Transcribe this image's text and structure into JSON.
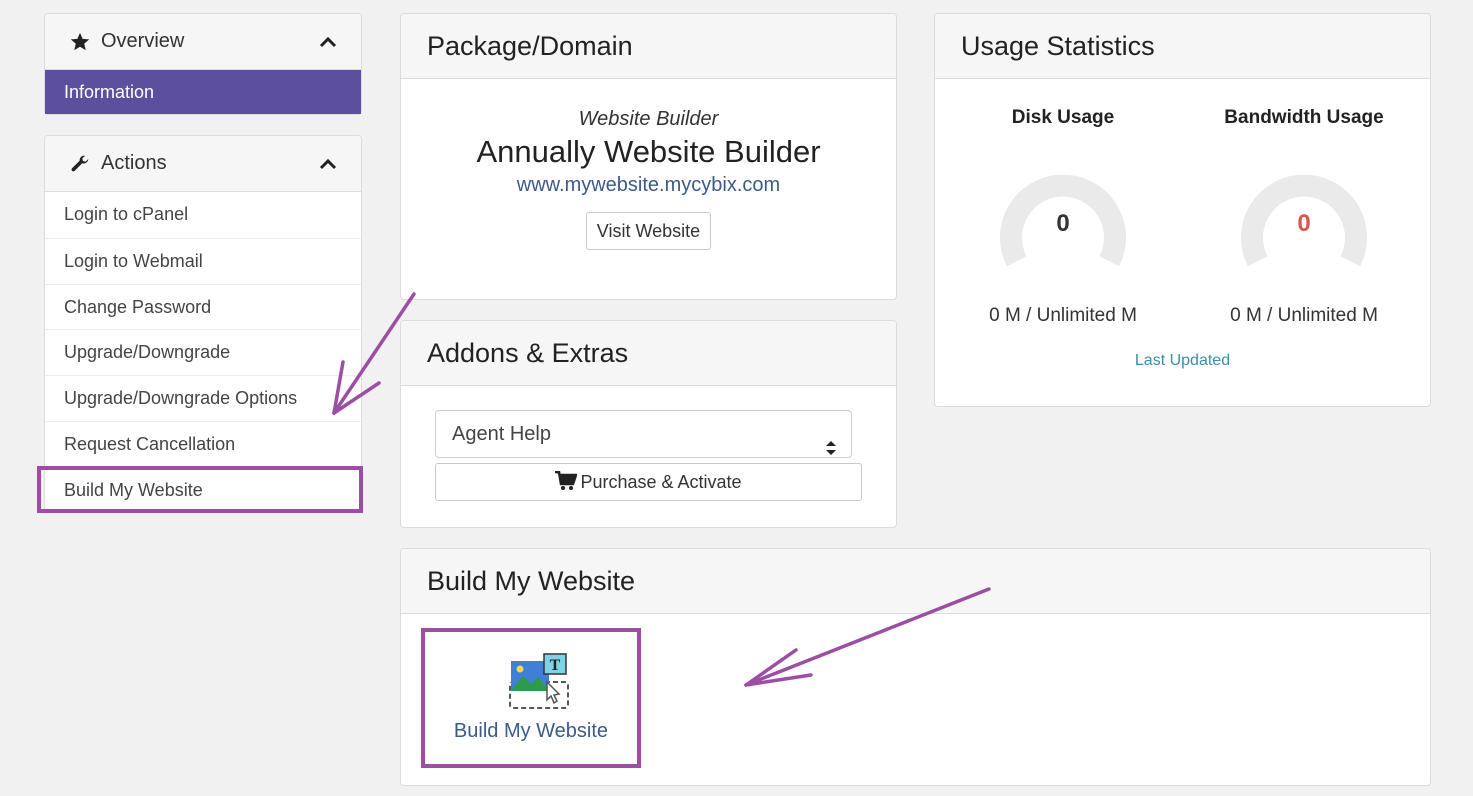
{
  "sidebar": {
    "overview": {
      "title": "Overview",
      "items": [
        {
          "label": "Information"
        }
      ]
    },
    "actions": {
      "title": "Actions",
      "items": [
        {
          "label": "Login to cPanel"
        },
        {
          "label": "Login to Webmail"
        },
        {
          "label": "Change Password"
        },
        {
          "label": "Upgrade/Downgrade"
        },
        {
          "label": "Upgrade/Downgrade Options"
        },
        {
          "label": "Request Cancellation"
        },
        {
          "label": "Build My Website"
        }
      ]
    }
  },
  "package": {
    "title": "Package/Domain",
    "product_group": "Website Builder",
    "product_name": "Annually Website Builder",
    "domain": "www.mywebsite.mycybix.com",
    "visit_label": "Visit Website"
  },
  "addons": {
    "title": "Addons & Extras",
    "selected": "Agent Help",
    "purchase_label": "Purchase & Activate"
  },
  "usage": {
    "title": "Usage Statistics",
    "disk": {
      "label": "Disk Usage",
      "value": "0",
      "usage": "0 M / Unlimited M"
    },
    "bandwidth": {
      "label": "Bandwidth Usage",
      "value": "0",
      "usage": "0 M / Unlimited M"
    },
    "last_updated": "Last Updated"
  },
  "builder": {
    "title": "Build My Website",
    "tile_label": "Build My Website"
  },
  "colors": {
    "accent": "#5c4f9e",
    "highlight": "#9b4ea3",
    "link": "#3d5a8a",
    "danger": "#d9534f"
  },
  "icons": [
    "star-icon",
    "chevron-up-icon",
    "wrench-icon",
    "select-caret-icon",
    "cart-icon",
    "site-builder-icon"
  ]
}
